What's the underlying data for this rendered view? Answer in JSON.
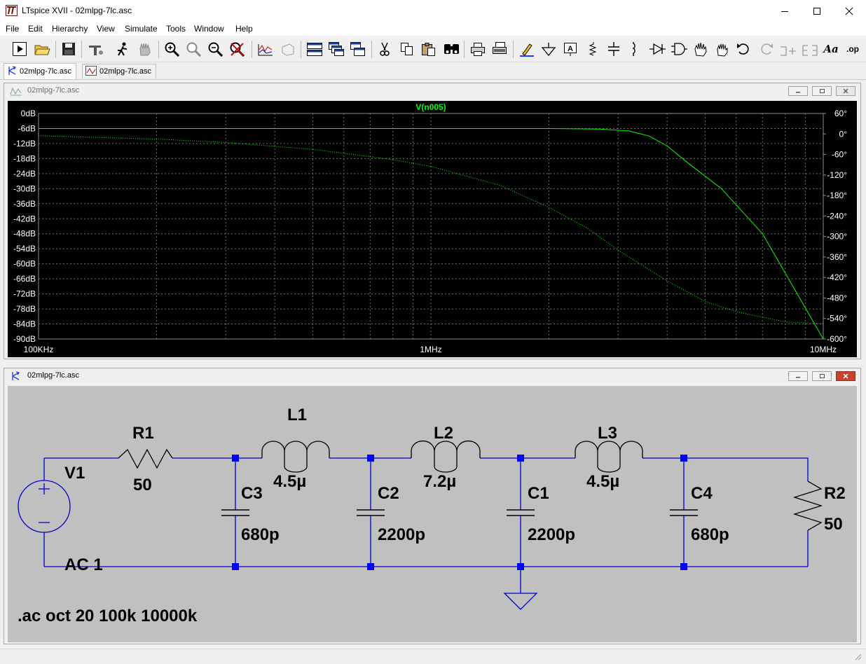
{
  "window": {
    "title": "LTspice XVII - 02mlpg-7lc.asc"
  },
  "menu": [
    "File",
    "Edit",
    "Hierarchy",
    "View",
    "Simulate",
    "Tools",
    "Window",
    "Help"
  ],
  "toolbar_icons": [
    "run-icon",
    "open-icon",
    "save-icon",
    "control-panel-icon",
    "autorange-icon",
    "pan-icon",
    "zoom-in-icon",
    "zoom-area-icon",
    "zoom-out-icon",
    "zoom-cancel-icon",
    "waveform-icon",
    "3d-view-icon",
    "tile-horizontal-icon",
    "cascade-icon",
    "tile-vertical-icon",
    "cut-icon",
    "copy-icon",
    "paste-icon",
    "find-icon",
    "print-icon",
    "print-setup-icon",
    "wire-icon",
    "ground-icon",
    "label-icon",
    "resistor-icon",
    "capacitor-icon",
    "inductor-icon",
    "diode-icon",
    "component-icon",
    "move-icon",
    "drag-icon",
    "undo-icon",
    "redo-icon",
    "rotate-icon",
    "mirror-icon",
    "text-icon",
    "spice-directive-icon"
  ],
  "toolbar_text": {
    "text_tool": "Aa",
    "directive_tool": ".op"
  },
  "tabs": [
    {
      "label": "02mlpg-7lc.asc",
      "active": true
    },
    {
      "label": "02mlpg-7lc.asc",
      "active": false
    }
  ],
  "plot_window": {
    "title": "02mlpg-7lc.asc",
    "trace_label": "V(n005)",
    "left_ticks": [
      "0dB",
      "-6dB",
      "-12dB",
      "-18dB",
      "-24dB",
      "-30dB",
      "-36dB",
      "-42dB",
      "-48dB",
      "-54dB",
      "-60dB",
      "-66dB",
      "-72dB",
      "-78dB",
      "-84dB",
      "-90dB"
    ],
    "right_ticks": [
      "60°",
      "0°",
      "-60°",
      "-120°",
      "-180°",
      "-240°",
      "-300°",
      "-360°",
      "-420°",
      "-480°",
      "-540°",
      "-600°"
    ],
    "x_ticks": [
      "100KHz",
      "1MHz",
      "10MHz"
    ]
  },
  "chart_data": {
    "type": "line",
    "title": "V(n005)",
    "x_scale": "log",
    "xlim": [
      100000,
      10000000
    ],
    "ylim_left": [
      -90,
      0
    ],
    "ylim_right": [
      -600,
      60
    ],
    "grid": true,
    "colors": {
      "background": "#000000",
      "grid": "#6e6e6e",
      "trace": "#00ff00",
      "axis_text": "#ffffff"
    },
    "series": [
      {
        "name": "V(n005)",
        "axis": "left",
        "style": "solid",
        "x": [
          100000,
          300000,
          1000000,
          2000000,
          2700000,
          3200000,
          3600000,
          4000000,
          4500000,
          5500000,
          7000000,
          10000000
        ],
        "y": [
          -6,
          -6,
          -6,
          -6,
          -6.2,
          -7,
          -9,
          -13,
          -19.5,
          -30,
          -48,
          -90
        ]
      },
      {
        "name": "V(n005)",
        "axis": "right",
        "style": "dotted",
        "x": [
          100000,
          200000,
          300000,
          500000,
          800000,
          1000000,
          1500000,
          2000000,
          2500000,
          3000000,
          4000000,
          5000000,
          6000000,
          8000000,
          10000000
        ],
        "y": [
          -5,
          -15,
          -25,
          -45,
          -75,
          -95,
          -150,
          -215,
          -275,
          -340,
          -430,
          -490,
          -520,
          -550,
          -555
        ]
      }
    ]
  },
  "schematic_window": {
    "title": "02mlpg-7lc.asc",
    "components": {
      "v1_name": "V1",
      "v1_value": "AC 1",
      "r1_name": "R1",
      "r1_value": "50",
      "l1_name": "L1",
      "l1_value": "4.5µ",
      "l2_name": "L2",
      "l2_value": "7.2µ",
      "l3_name": "L3",
      "l3_value": "4.5µ",
      "c1_name": "C1",
      "c1_value": "2200p",
      "c2_name": "C2",
      "c2_value": "2200p",
      "c3_name": "C3",
      "c3_value": "680p",
      "c4_name": "C4",
      "c4_value": "680p",
      "r2_name": "R2",
      "r2_value": "50"
    },
    "directive": ".ac oct 20 100k 10000k",
    "colors": {
      "background": "#c0c0c0",
      "wire": "#0000c8",
      "junction": "#0000ff"
    }
  }
}
